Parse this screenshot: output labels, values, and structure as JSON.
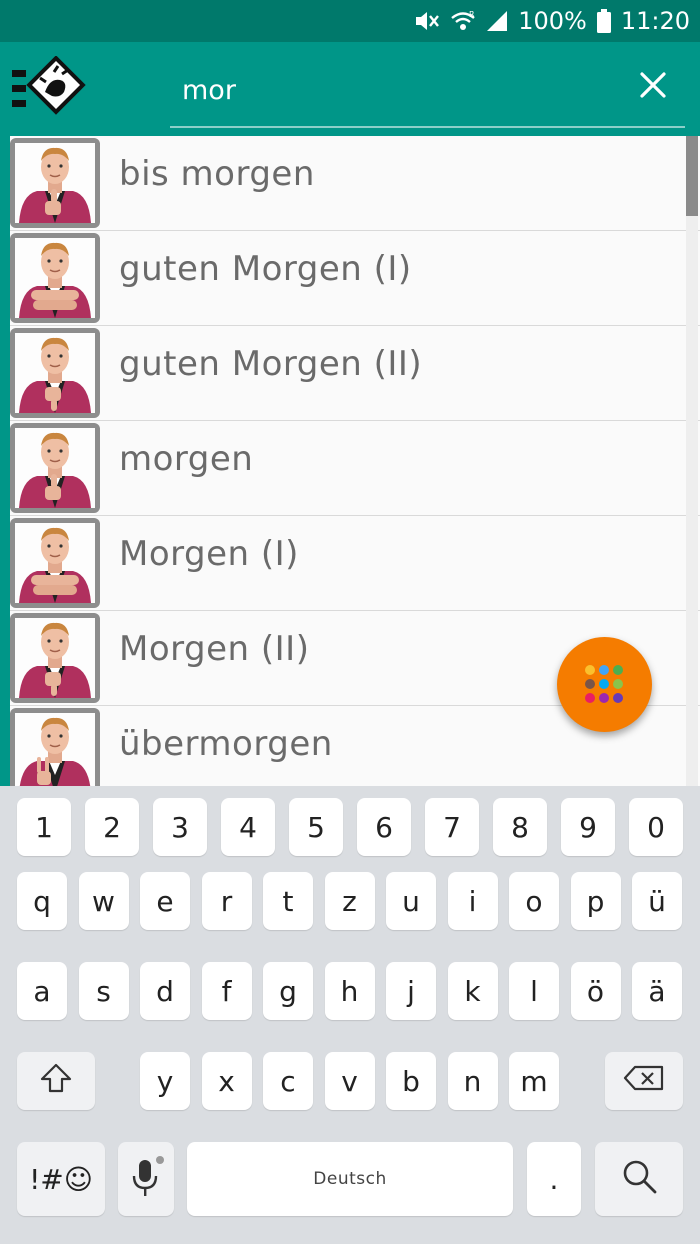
{
  "status_bar": {
    "battery": "100%",
    "time": "11:20",
    "icons": [
      "mute-icon",
      "wifi-icon",
      "signal-icon",
      "battery-icon"
    ]
  },
  "search": {
    "query": "mor",
    "logo_icon": "sign-language-logo",
    "clear_icon": "close-icon"
  },
  "results": [
    {
      "label": "bis morgen",
      "pose": "thumb"
    },
    {
      "label": "guten Morgen (I)",
      "pose": "flat"
    },
    {
      "label": "guten Morgen (II)",
      "pose": "down"
    },
    {
      "label": "morgen",
      "pose": "thumb"
    },
    {
      "label": "Morgen (I)",
      "pose": "flat"
    },
    {
      "label": "Morgen (II)",
      "pose": "down"
    },
    {
      "label": "übermorgen",
      "pose": "two"
    }
  ],
  "fab": {
    "icon": "grid-menu-icon",
    "dot_colors": [
      "#fbc02d",
      "#42a5f5",
      "#4caf50",
      "#795548",
      "#03a9f4",
      "#8bc34a",
      "#e91e63",
      "#9c27b0",
      "#673ab7"
    ]
  },
  "keyboard": {
    "number_row": [
      "1",
      "2",
      "3",
      "4",
      "5",
      "6",
      "7",
      "8",
      "9",
      "0"
    ],
    "row1": [
      "q",
      "w",
      "e",
      "r",
      "t",
      "z",
      "u",
      "i",
      "o",
      "p",
      "ü"
    ],
    "row2": [
      "a",
      "s",
      "d",
      "f",
      "g",
      "h",
      "j",
      "k",
      "l",
      "ö",
      "ä"
    ],
    "row3": [
      "y",
      "x",
      "c",
      "v",
      "b",
      "n",
      "m"
    ],
    "symbols_label": "!#☺",
    "space_label": "Deutsch",
    "period_label": "."
  },
  "colors": {
    "status_bar": "#00796b",
    "app_bar": "#009688",
    "fab": "#f57c00",
    "label_text": "#6a6a6a"
  }
}
